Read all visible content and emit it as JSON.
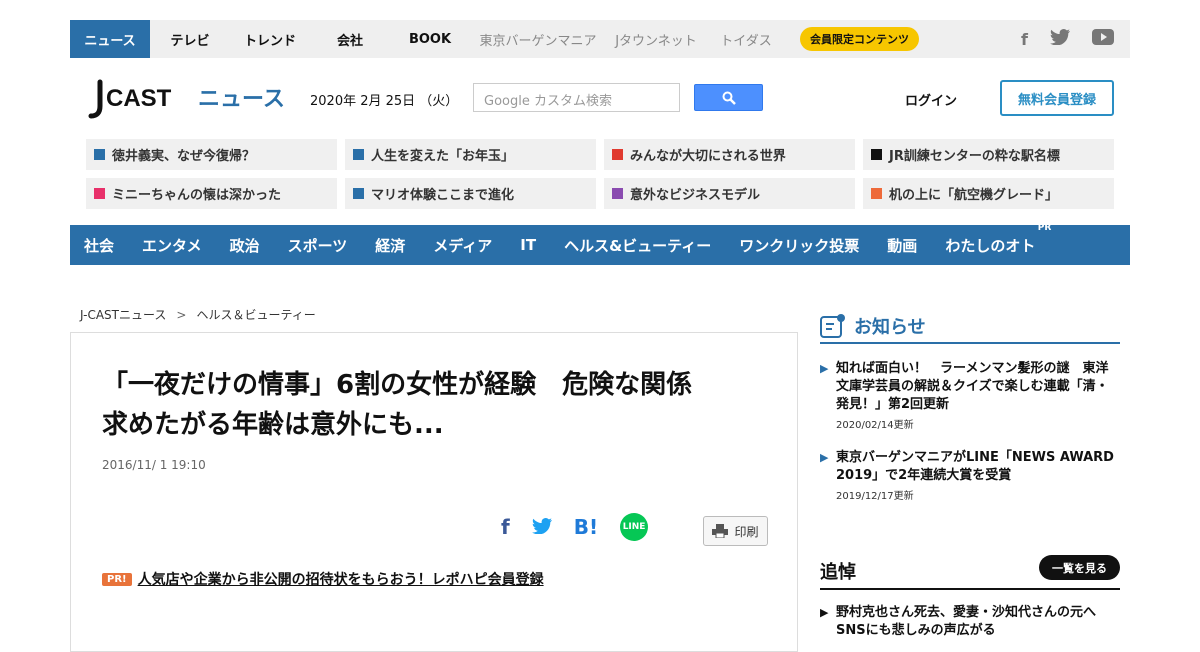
{
  "topnav": {
    "items": [
      {
        "label": "ニュース"
      },
      {
        "label": "テレビ"
      },
      {
        "label": "トレンド"
      },
      {
        "label": "会社"
      },
      {
        "label": "BOOK"
      },
      {
        "label": "東京バーゲンマニア"
      },
      {
        "label": "Jタウンネット"
      },
      {
        "label": "トイダス"
      }
    ],
    "member_badge": "会員限定コンテンツ",
    "social": {
      "facebook": "f",
      "twitter": "🐦",
      "youtube": "▶"
    }
  },
  "header": {
    "logo_main": "J-CAST",
    "logo_sub": "ニュース",
    "date": "2020年 2月 25日 （火）",
    "search_placeholder": "Google カスタム検索",
    "login": "ログイン",
    "register": "無料会員登録"
  },
  "topics": [
    {
      "label": "徳井義実、なぜ今復帰？",
      "color": "#2a6fa8"
    },
    {
      "label": "人生を変えた「お年玉」",
      "color": "#2a6fa8"
    },
    {
      "label": "みんなが大切にされる世界",
      "color": "#e03a2f"
    },
    {
      "label": "JR訓練センターの粋な駅名標",
      "color": "#111111"
    },
    {
      "label": "ミニーちゃんの懐は深かった",
      "color": "#e8306a"
    },
    {
      "label": "マリオ体験ここまで進化",
      "color": "#2a6fa8"
    },
    {
      "label": "意外なビジネスモデル",
      "color": "#8a4bb0"
    },
    {
      "label": "机の上に「航空機グレード」",
      "color": "#ee6a3a"
    }
  ],
  "categories": [
    {
      "label": "社会"
    },
    {
      "label": "エンタメ"
    },
    {
      "label": "政治"
    },
    {
      "label": "スポーツ"
    },
    {
      "label": "経済"
    },
    {
      "label": "メディア"
    },
    {
      "label": "IT"
    },
    {
      "label": "ヘルス&ビューティー"
    },
    {
      "label": "ワンクリック投票"
    },
    {
      "label": "動画"
    },
    {
      "label": "わたしのオト",
      "pr": "PR"
    }
  ],
  "breadcrumb": {
    "home": "J-CASTニュース",
    "sep": ">",
    "section": "ヘルス＆ビューティー"
  },
  "article": {
    "title_line1": "「一夜だけの情事」6割の女性が経験　危険な関係",
    "title_line2": "求めたがる年齢は意外にも...",
    "date": "2016/11/ 1 19:10",
    "print": "印刷",
    "line_label": "LINE",
    "pr_badge": "PR!",
    "pr_link": "人気店や企業から非公開の招待状をもらおう！レポハピ会員登録"
  },
  "sidebar": {
    "notice_title": "お知らせ",
    "notices": [
      {
        "text": "知れば面白い！　ラーメンマン髪形の謎　東洋文庫学芸員の解説＆クイズで楽しむ連載「清・発見！」第2回更新",
        "date": "2020/02/14更新"
      },
      {
        "text": "東京バーゲンマニアがLINE「NEWS AWARD 2019」で2年連続大賞を受賞",
        "date": "2019/12/17更新"
      }
    ],
    "mourning_title": "追悼",
    "mourning_button": "一覧を見る",
    "mourning_item": "野村克也さん死去、愛妻・沙知代さんの元へ　SNSにも悲しみの声広がる"
  },
  "colors": {
    "brand": "#2a6fa8",
    "badge": "#f7c600",
    "register": "#2a8ec4",
    "line": "#06c755"
  }
}
